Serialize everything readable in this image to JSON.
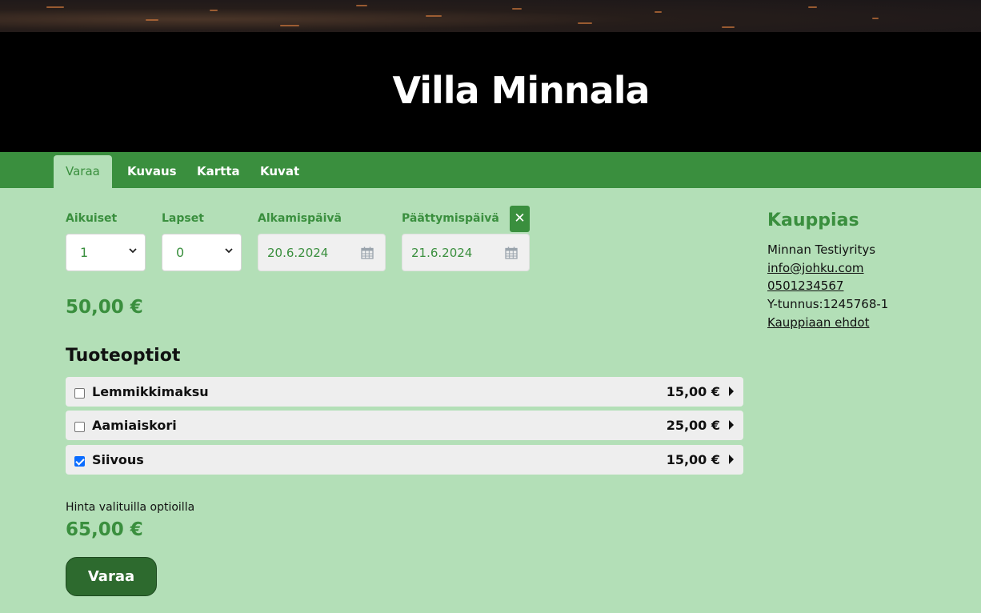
{
  "header": {
    "title": "Villa Minnala"
  },
  "tabs": [
    {
      "label": "Varaa",
      "active": true
    },
    {
      "label": "Kuvaus"
    },
    {
      "label": "Kartta"
    },
    {
      "label": "Kuvat"
    }
  ],
  "booking": {
    "adults": {
      "label": "Aikuiset",
      "value": "1"
    },
    "children": {
      "label": "Lapset",
      "value": "0"
    },
    "start_date": {
      "label": "Alkamispäivä",
      "value": "20.6.2024"
    },
    "end_date": {
      "label": "Päättymispäivä",
      "value": "21.6.2024"
    },
    "clear_symbol": "✕",
    "base_price": "50,00 €"
  },
  "options": {
    "title": "Tuoteoptiot",
    "items": [
      {
        "name": "Lemmikkimaksu",
        "price": "15,00 €",
        "checked": false
      },
      {
        "name": "Aamiaiskori",
        "price": "25,00 €",
        "checked": false
      },
      {
        "name": "Siivous",
        "price": "15,00 €",
        "checked": true
      }
    ]
  },
  "total": {
    "label": "Hinta valituilla optioilla",
    "price": "65,00 €"
  },
  "book_button": "Varaa",
  "merchant": {
    "title": "Kauppias",
    "name": "Minnan Testiyritys",
    "email": "info@johku.com",
    "phone": "0501234567",
    "business_id": "Y-tunnus:1245768-1",
    "terms_link": "Kauppiaan ehdot"
  },
  "colors": {
    "accent": "#3a8f3e",
    "background": "#b3dfb7",
    "button": "#2d6a2e"
  }
}
